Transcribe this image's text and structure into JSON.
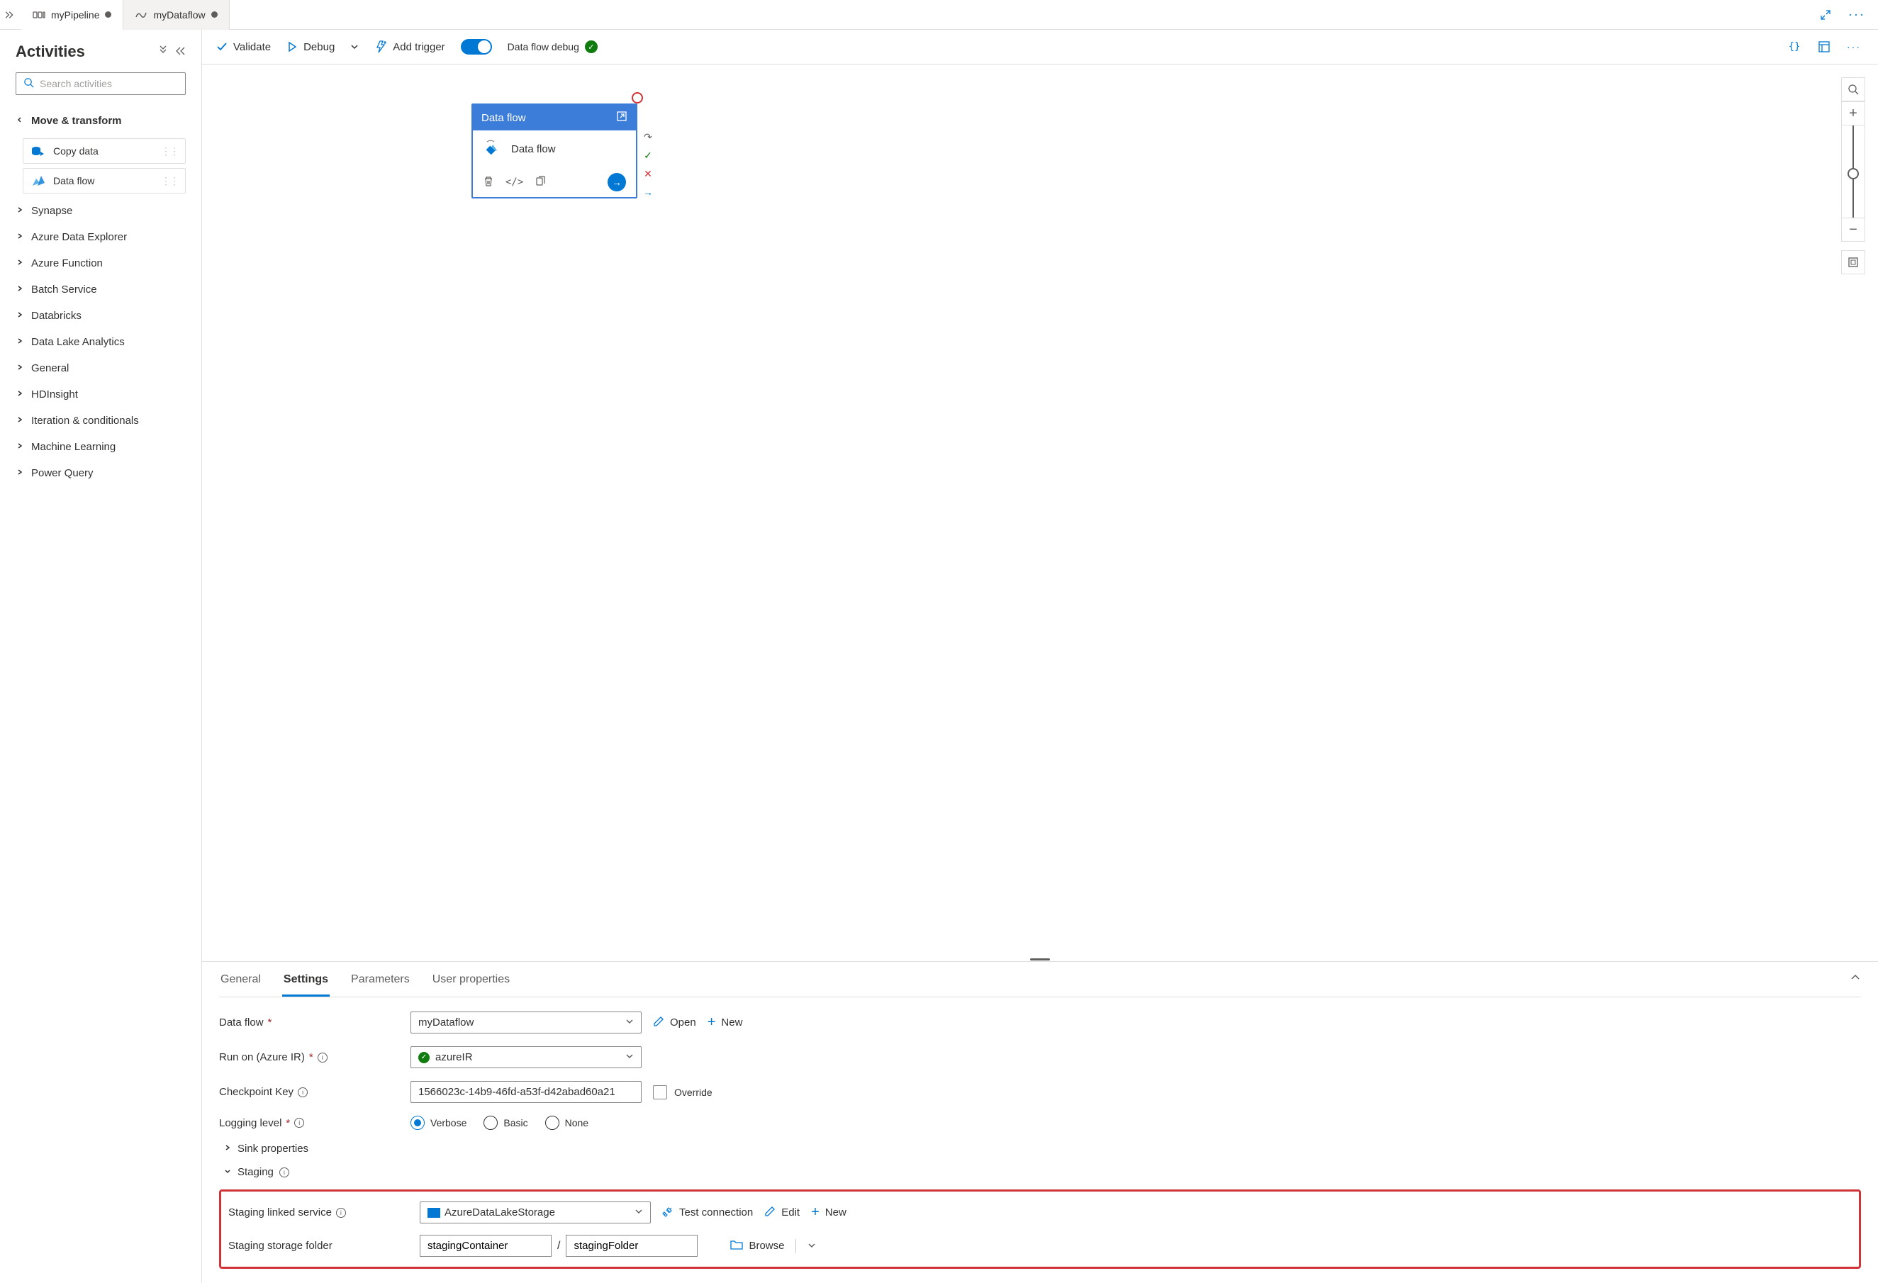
{
  "tabs": [
    {
      "label": "myPipeline",
      "dirty": true
    },
    {
      "label": "myDataflow",
      "dirty": true
    }
  ],
  "sidebar": {
    "title": "Activities",
    "search_placeholder": "Search activities",
    "cat_move_transform": "Move & transform",
    "act_copy_data": "Copy data",
    "act_data_flow": "Data flow",
    "cat_synapse": "Synapse",
    "cat_ade": "Azure Data Explorer",
    "cat_af": "Azure Function",
    "cat_batch": "Batch Service",
    "cat_databricks": "Databricks",
    "cat_dla": "Data Lake Analytics",
    "cat_general": "General",
    "cat_hdi": "HDInsight",
    "cat_iter": "Iteration & conditionals",
    "cat_ml": "Machine Learning",
    "cat_pq": "Power Query"
  },
  "toolbar": {
    "validate": "Validate",
    "debug": "Debug",
    "add_trigger": "Add trigger",
    "debug_toggle": "Data flow debug"
  },
  "node": {
    "title": "Data flow",
    "body": "Data flow"
  },
  "props": {
    "tab_general": "General",
    "tab_settings": "Settings",
    "tab_parameters": "Parameters",
    "tab_user": "User properties",
    "lbl_dataflow": "Data flow",
    "val_dataflow": "myDataflow",
    "open": "Open",
    "new": "New",
    "lbl_runon": "Run on (Azure IR)",
    "val_runon": "azureIR",
    "lbl_checkpoint": "Checkpoint Key",
    "val_checkpoint": "1566023c-14b9-46fd-a53f-d42abad60a21",
    "override": "Override",
    "lbl_logging": "Logging level",
    "log_verbose": "Verbose",
    "log_basic": "Basic",
    "log_none": "None",
    "sink_props": "Sink properties",
    "staging": "Staging",
    "lbl_staging_ls": "Staging linked service",
    "val_staging_ls": "AzureDataLakeStorage",
    "test_conn": "Test connection",
    "edit": "Edit",
    "lbl_staging_folder": "Staging storage folder",
    "val_container": "stagingContainer",
    "val_folder": "stagingFolder",
    "browse": "Browse"
  }
}
